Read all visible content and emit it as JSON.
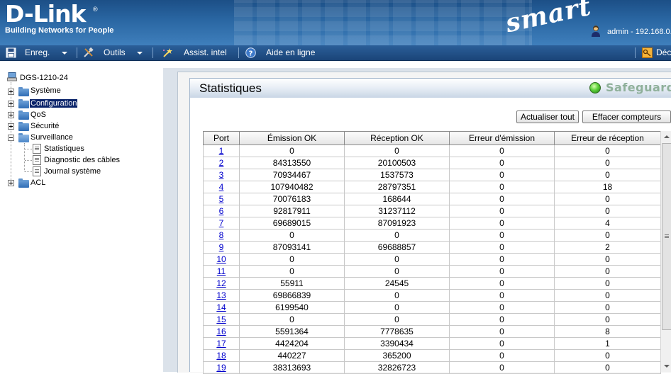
{
  "header": {
    "logo_text": "D-Link",
    "logo_reg": "®",
    "tagline": "Building Networks for People",
    "product_logo": "smart",
    "user_info": "admin - 192.168.0."
  },
  "toolbar": {
    "save_label": "Enreg.",
    "tools_label": "Outils",
    "wizard_label": "Assist. intel",
    "help_label": "Aide en ligne",
    "logout_label": "Déc"
  },
  "tree": {
    "root": "DGS-1210-24",
    "items": [
      "Système",
      "Configuration",
      "QoS",
      "Sécurité",
      "Surveillance",
      "ACL"
    ],
    "surveillance_children": [
      "Statistiques",
      "Diagnostic des câbles",
      "Journal système"
    ]
  },
  "panel": {
    "title": "Statistiques",
    "safeguard": "Safeguard",
    "refresh_label": "Actualiser tout",
    "clear_label": "Effacer compteurs"
  },
  "table": {
    "headers": [
      "Port",
      "Émission OK",
      "Réception OK",
      "Erreur d'émission",
      "Erreur de réception"
    ],
    "rows": [
      [
        "1",
        "0",
        "0",
        "0",
        "0"
      ],
      [
        "2",
        "84313550",
        "20100503",
        "0",
        "0"
      ],
      [
        "3",
        "70934467",
        "1537573",
        "0",
        "0"
      ],
      [
        "4",
        "107940482",
        "28797351",
        "0",
        "18"
      ],
      [
        "5",
        "70076183",
        "168644",
        "0",
        "0"
      ],
      [
        "6",
        "92817911",
        "31237112",
        "0",
        "0"
      ],
      [
        "7",
        "69689015",
        "87091923",
        "0",
        "4"
      ],
      [
        "8",
        "0",
        "0",
        "0",
        "0"
      ],
      [
        "9",
        "87093141",
        "69688857",
        "0",
        "2"
      ],
      [
        "10",
        "0",
        "0",
        "0",
        "0"
      ],
      [
        "11",
        "0",
        "0",
        "0",
        "0"
      ],
      [
        "12",
        "55911",
        "24545",
        "0",
        "0"
      ],
      [
        "13",
        "69866839",
        "0",
        "0",
        "0"
      ],
      [
        "14",
        "6199540",
        "0",
        "0",
        "0"
      ],
      [
        "15",
        "0",
        "0",
        "0",
        "0"
      ],
      [
        "16",
        "5591364",
        "7778635",
        "0",
        "8"
      ],
      [
        "17",
        "4424204",
        "3390434",
        "0",
        "1"
      ],
      [
        "18",
        "440227",
        "365200",
        "0",
        "0"
      ],
      [
        "19",
        "38313693",
        "32826723",
        "0",
        "0"
      ]
    ]
  },
  "icons": {
    "save": "floppy-disk-icon",
    "tools": "tools-icon",
    "wizard": "wand-icon",
    "help": "help-icon",
    "logout": "key-icon",
    "user": "user-icon",
    "safeguard": "green-led-icon"
  }
}
